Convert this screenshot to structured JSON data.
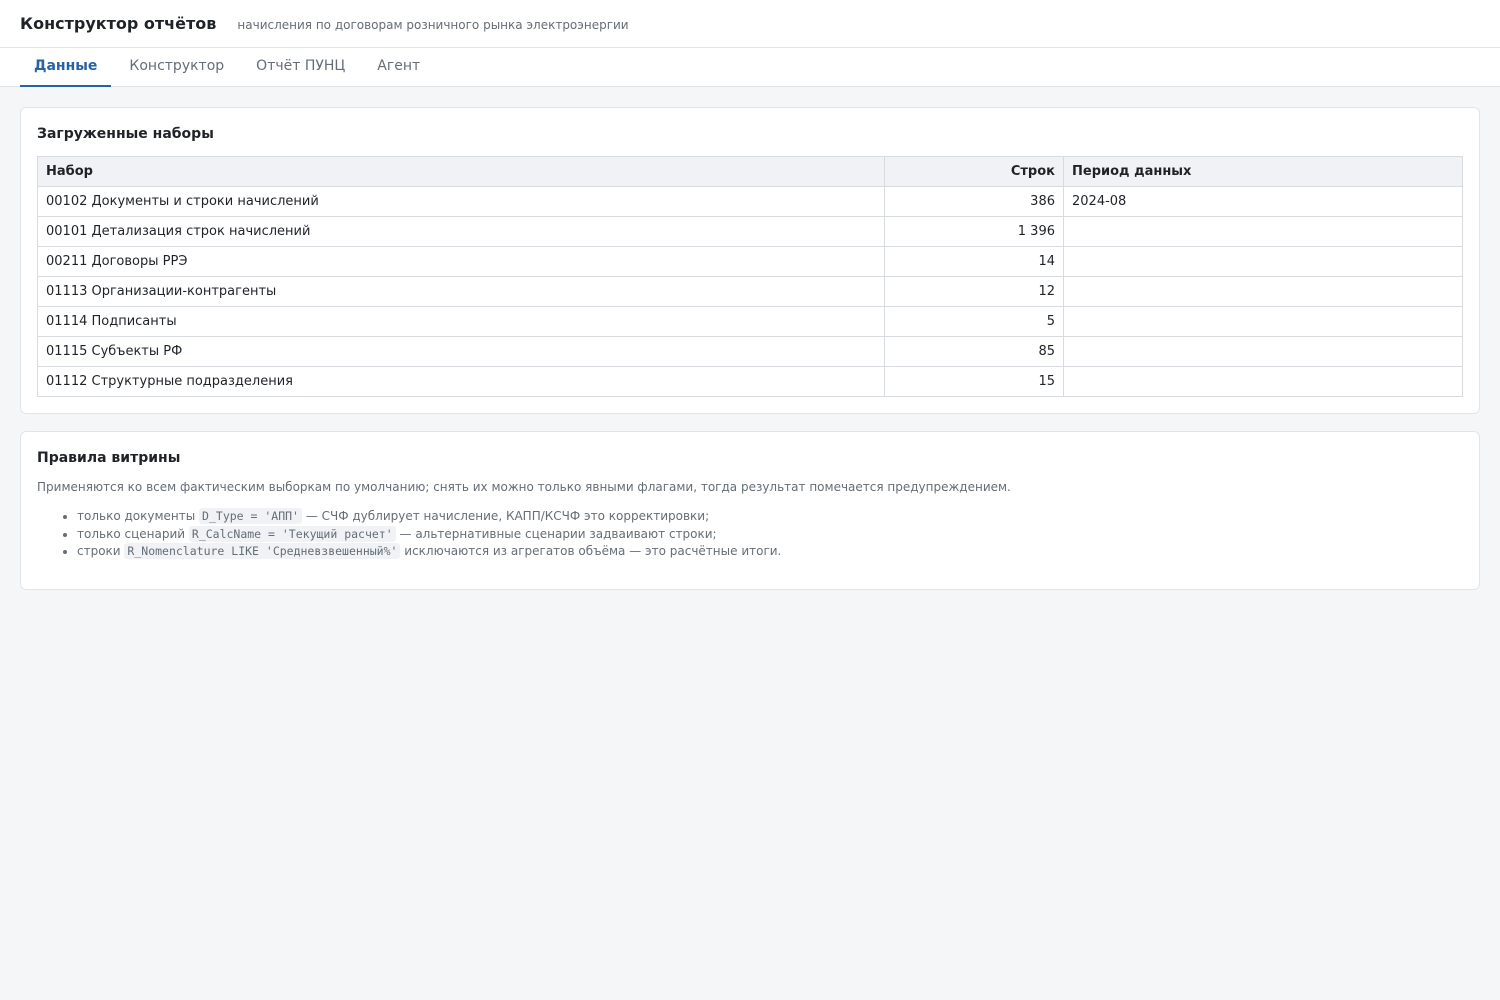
{
  "header": {
    "title": "Конструктор отчётов",
    "subtitle": "начисления по договорам розничного рынка электроэнергии"
  },
  "tabs": [
    {
      "label": "Данные",
      "active": true
    },
    {
      "label": "Конструктор",
      "active": false
    },
    {
      "label": "Отчёт ПУНЦ",
      "active": false
    },
    {
      "label": "Агент",
      "active": false
    }
  ],
  "datasets": {
    "title": "Загруженные наборы",
    "columns": [
      "Набор",
      "Строк",
      "Период данных"
    ],
    "rows": [
      {
        "name": "00102 Документы и строки начислений",
        "count": "386",
        "period": "2024-08"
      },
      {
        "name": "00101 Детализация строк начислений",
        "count": "1 396",
        "period": ""
      },
      {
        "name": "00211 Договоры РРЭ",
        "count": "14",
        "period": ""
      },
      {
        "name": "01113 Организации-контрагенты",
        "count": "12",
        "period": ""
      },
      {
        "name": "01114 Подписанты",
        "count": "5",
        "period": ""
      },
      {
        "name": "01115 Субъекты РФ",
        "count": "85",
        "period": ""
      },
      {
        "name": "01112 Структурные подразделения",
        "count": "15",
        "period": ""
      }
    ]
  },
  "rules": {
    "title": "Правила витрины",
    "description": "Применяются ко всем фактическим выборкам по умолчанию; снять их можно только явными флагами, тогда результат помечается предупреждением.",
    "items": [
      {
        "before": "только документы",
        "code": "D_Type = 'АПП'",
        "after": "— СЧФ дублирует начисление, КАПП/КСЧФ это корректировки;"
      },
      {
        "before": "только сценарий",
        "code": "R_CalcName = 'Текущий расчет'",
        "after": "— альтернативные сценарии задваивают строки;"
      },
      {
        "before": "строки",
        "code": "R_Nomenclature LIKE 'Средневзвешенный%'",
        "after": "исключаются из агрегатов объёма — это расчётные итоги."
      }
    ]
  }
}
